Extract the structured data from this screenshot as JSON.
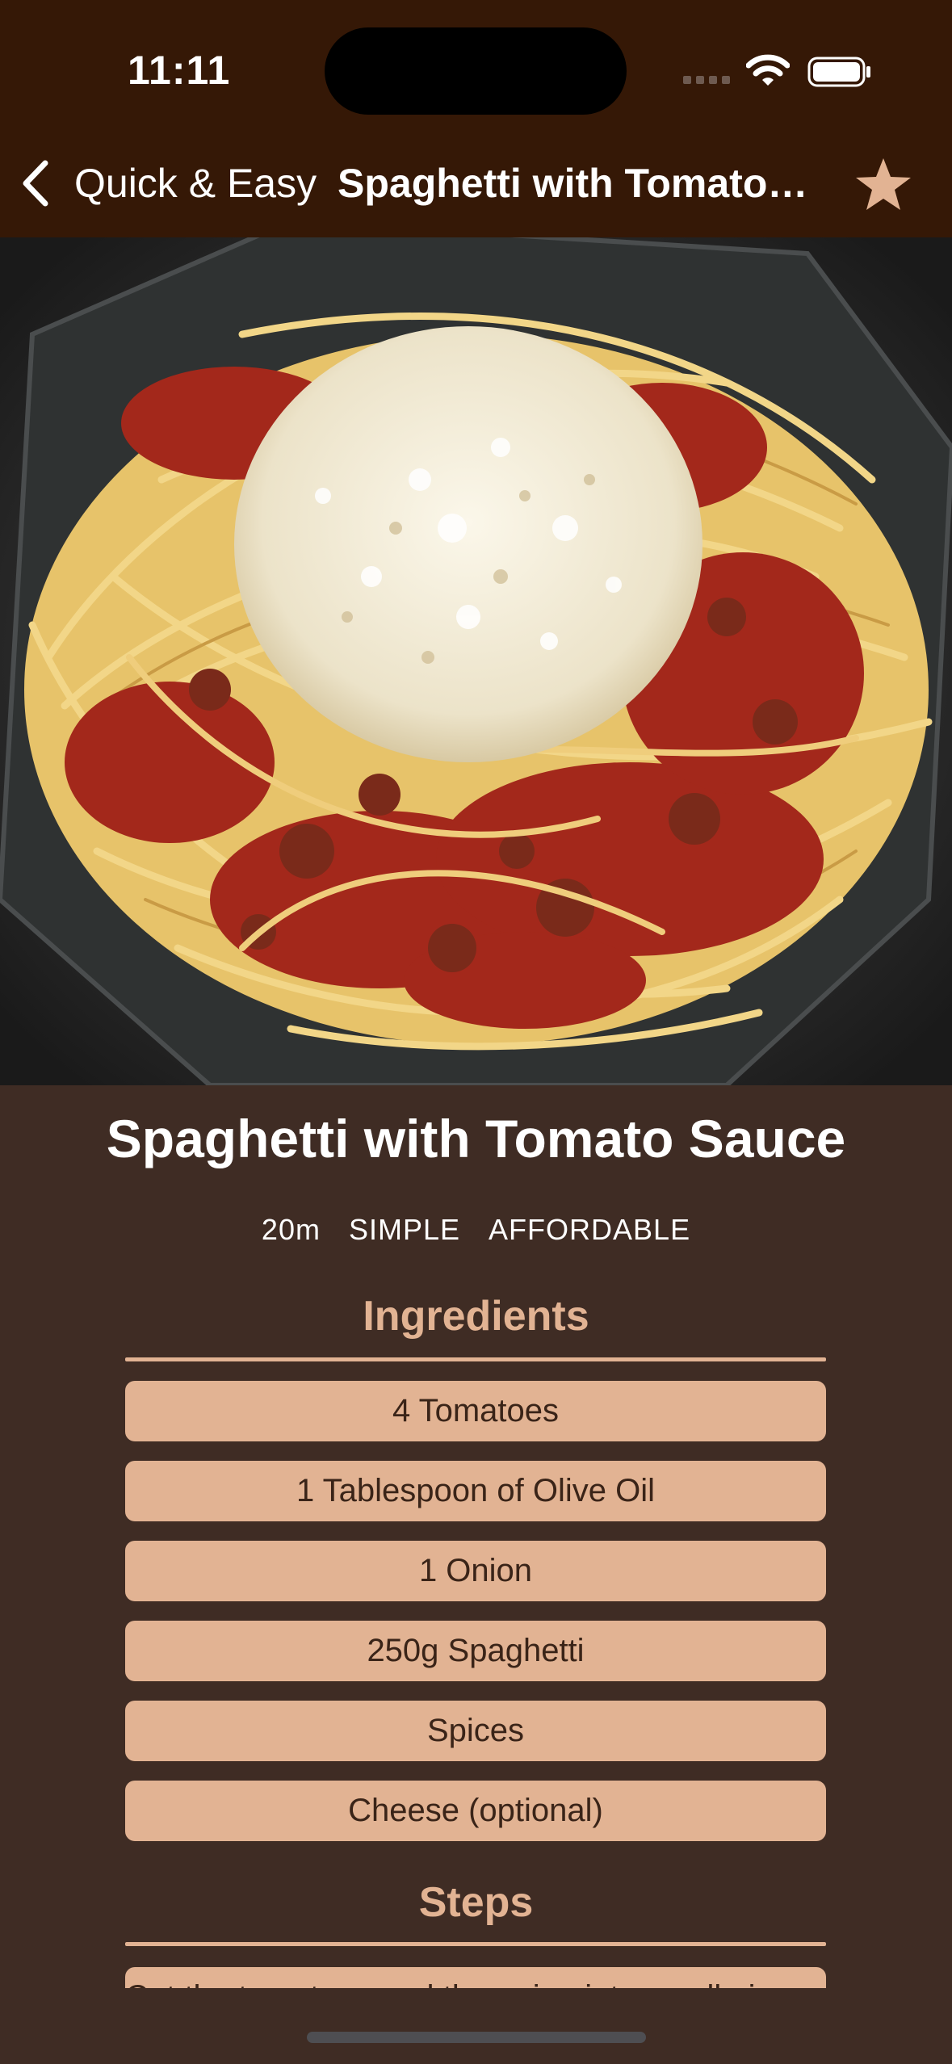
{
  "status": {
    "time": "11:11"
  },
  "nav": {
    "back_label": "Quick & Easy",
    "title": "Spaghetti with Tomato Sauce"
  },
  "hero": {
    "image_alt": "Plate of spaghetti with tomato sauce and grated cheese"
  },
  "recipe": {
    "title": "Spaghetti with Tomato Sauce",
    "duration": "20m",
    "complexity": "SIMPLE",
    "affordability": "AFFORDABLE"
  },
  "ingredients": {
    "title": "Ingredients",
    "items": [
      "4 Tomatoes",
      "1 Tablespoon of Olive Oil",
      "1 Onion",
      "250g Spaghetti",
      "Spices",
      "Cheese (optional)"
    ]
  },
  "steps": {
    "title": "Steps",
    "first_step": "Cut the tomatoes and the onion into small pieces."
  },
  "colors": {
    "header_bg": "#351806",
    "page_bg": "#3f2c24",
    "accent": "#e2b393",
    "text_light": "#ffffff"
  },
  "icons": [
    "back-chevron-icon",
    "star-icon",
    "wifi-icon",
    "battery-icon",
    "signal-icon"
  ]
}
